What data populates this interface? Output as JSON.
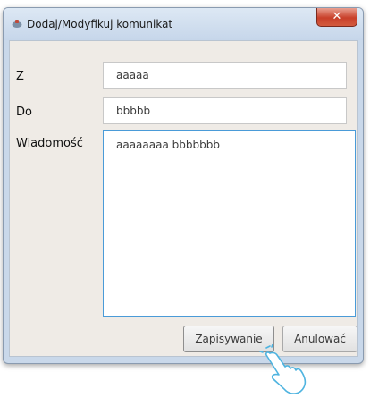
{
  "window": {
    "title": "Dodaj/Modyfikuj komunikat",
    "icon": "app-icon",
    "close_label": "✕"
  },
  "form": {
    "from": {
      "label": "Z",
      "value": "aaaaa"
    },
    "to": {
      "label": "Do",
      "value": "bbbbb"
    },
    "message": {
      "label": "Wiadomość",
      "value": "aaaaaaaa bbbbbbb"
    }
  },
  "buttons": {
    "save_label": "Zapisywanie",
    "cancel_label": "Anulować"
  },
  "colors": {
    "accent": "#4a9bd8",
    "close_button": "#c8402a",
    "panel_background": "#efebe6"
  },
  "icons": [
    "app-icon",
    "close-icon",
    "hand-pointer-icon"
  ]
}
